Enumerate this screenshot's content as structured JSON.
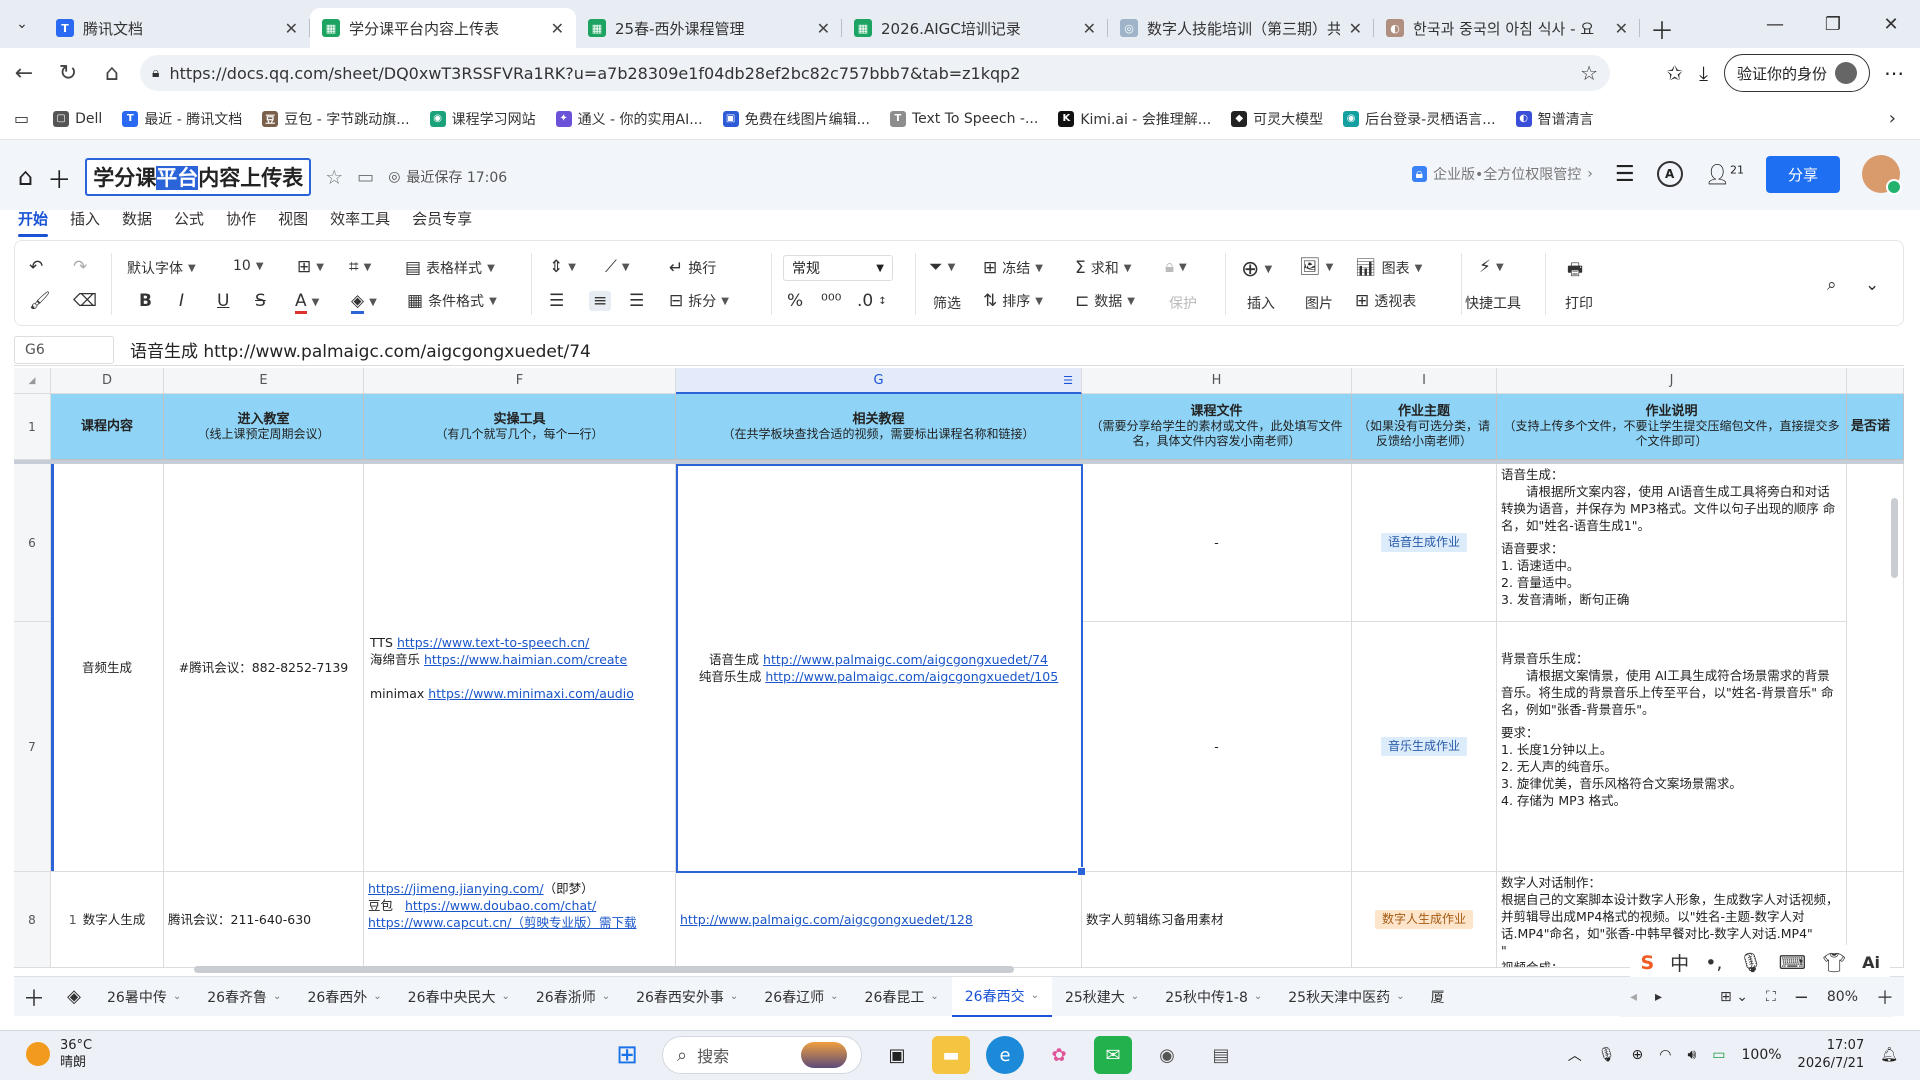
{
  "browser": {
    "tabs": [
      {
        "title": "腾讯文档",
        "color": "#2a6af2",
        "glyph": "T",
        "active": false
      },
      {
        "title": "学分课平台内容上传表",
        "color": "#1ea462",
        "glyph": "▦",
        "active": true
      },
      {
        "title": "25春-西外课程管理",
        "color": "#1ea462",
        "glyph": "▦",
        "active": false
      },
      {
        "title": "2026.AIGC培训记录",
        "color": "#1ea462",
        "glyph": "▦",
        "active": false
      },
      {
        "title": "数字人技能培训（第三期）共",
        "color": "#9fb4c8",
        "glyph": "◎",
        "active": false
      },
      {
        "title": "한국과 중국의 아침 식사 - 요",
        "color": "#b08f80",
        "glyph": "◐",
        "active": false
      }
    ],
    "url": "https://docs.qq.com/sheet/DQ0xwT3RSSFVRa1RK?u=a7b28309e1f04db28ef2bc82c757bbb7&tab=z1kqp2",
    "verify_label": "验证你的身份",
    "bookmarks": [
      {
        "label": "Dell",
        "color": "#555555",
        "glyph": "▢"
      },
      {
        "label": "最近 - 腾讯文档",
        "color": "#2a6af2",
        "glyph": "T"
      },
      {
        "label": "豆包 - 字节跳动旗...",
        "color": "#7a5f4b",
        "glyph": "豆"
      },
      {
        "label": "课程学习网站",
        "color": "#1aa37a",
        "glyph": "◉"
      },
      {
        "label": "通义 - 你的实用AI...",
        "color": "#6b52d8",
        "glyph": "✦"
      },
      {
        "label": "免费在线图片编辑...",
        "color": "#2e5bd6",
        "glyph": "▣"
      },
      {
        "label": "Text To Speech -...",
        "color": "#8d8d8d",
        "glyph": "T"
      },
      {
        "label": "Kimi.ai - 会推理解...",
        "color": "#111111",
        "glyph": "K"
      },
      {
        "label": "可灵大模型",
        "color": "#222222",
        "glyph": "◆"
      },
      {
        "label": "后台登录-灵栖语言...",
        "color": "#14a0a0",
        "glyph": "◉"
      },
      {
        "label": "智谱清言",
        "color": "#3a4fd8",
        "glyph": "◐"
      }
    ]
  },
  "doc": {
    "title_pre": "学分课",
    "title_hl": "平台",
    "title_post": "内容上传表",
    "save_status": "最近保存 17:06",
    "permission": "企业版•全方位权限管控",
    "collab_count": "21",
    "share_label": "分享",
    "menus": [
      "开始",
      "插入",
      "数据",
      "公式",
      "协作",
      "视图",
      "效率工具",
      "会员专享"
    ]
  },
  "toolbar": {
    "font": "默认字体",
    "size": "10",
    "wrap": "换行",
    "format": "常规",
    "table_style": "表格样式",
    "cond_format": "条件格式",
    "split": "拆分",
    "freeze": "冻结",
    "sum": "求和",
    "filter": "筛选",
    "sort": "排序",
    "data": "数据",
    "protect": "保护",
    "insert": "插入",
    "image": "图片",
    "chart": "图表",
    "pivot": "透视表",
    "quick_tools": "快捷工具",
    "print": "打印"
  },
  "formula": {
    "cell_ref": "G6",
    "content": "语音生成 http://www.palmaigc.com/aigcgongxuedet/74"
  },
  "grid": {
    "col_letters": [
      "D",
      "E",
      "F",
      "G",
      "H",
      "I",
      "J"
    ],
    "headers": {
      "D": {
        "title": "课程内容",
        "sub": ""
      },
      "E": {
        "title": "进入教室",
        "sub": "（线上课预定周期会议）"
      },
      "F": {
        "title": "实操工具",
        "sub": "（有几个就写几个，每个一行）"
      },
      "G": {
        "title": "相关教程",
        "sub": "（在共学板块查找合适的视频，需要标出课程名称和链接）"
      },
      "H": {
        "title": "课程文件",
        "sub": "（需要分享给学生的素材或文件，此处填写文件名，具体文件内容发小南老师）"
      },
      "I": {
        "title": "作业主题",
        "sub": "（如果没有可选分类，请反馈给小南老师）"
      },
      "J": {
        "title": "作业说明",
        "sub": "（支持上传多个文件，不要让学生提交压缩包文件，直接提交多个文件即可）"
      },
      "K": {
        "title": "是否诺",
        "sub": ""
      }
    },
    "row_numbers": [
      "1",
      "6",
      "7",
      "8"
    ],
    "audio": {
      "course": "音频生成",
      "meeting": "#腾讯会议：882-8252-7139",
      "tools": [
        {
          "name": "TTS",
          "link": "https://www.text-to-speech.cn/"
        },
        {
          "name": "海绵音乐",
          "link": "https://www.haimian.com/create"
        },
        {
          "name": "minimax",
          "link": "https://www.minimaxi.com/audio"
        }
      ],
      "tutorials": [
        {
          "name": "语音生成",
          "link": "http://www.palmaigc.com/aigcgongxuedet/74"
        },
        {
          "name": "纯音乐生成",
          "link": "http://www.palmaigc.com/aigcgongxuedet/105"
        }
      ],
      "file6": "-",
      "file7": "-",
      "topic6": "语音生成作业",
      "topic7": "音乐生成作业",
      "desc6": {
        "title": "语音生成：",
        "body": "请根据所文案内容，使用 AI语音生成工具将旁白和对话转换为语音，并保存为 MP3格式。文件以句子出现的顺序 命名，如\"姓名-语音生成1\"。",
        "req_title": "语音要求：",
        "reqs": [
          "1. 语速适中。",
          "2. 音量适中。",
          "3. 发音清晰，断句正确"
        ]
      },
      "desc7": {
        "title": "背景音乐生成：",
        "body": "请根据文案情景，使用 AI工具生成符合场景需求的背景音乐。将生成的背景音乐上传至平台，以\"姓名-背景音乐\" 命名，例如\"张香-背景音乐\"。",
        "req_title": "要求：",
        "reqs": [
          "1. 长度1分钟以上。",
          "2. 无人声的纯音乐。",
          "3. 旋律优美，音乐风格符合文案场景需求。",
          "4. 存储为 MP3 格式。"
        ]
      }
    },
    "digital": {
      "index": "1",
      "course": "数字人生成",
      "meeting": "腾讯会议：211-640-630",
      "tool1_link": "https://jimeng.jianying.com/",
      "tool1_note": "（即梦）",
      "tool2_name": "豆包",
      "tool2_link": "https://www.doubao.com/chat/",
      "tool3_link": "https://www.capcut.cn/（剪映专业版）需下载",
      "tutorial": "http://www.palmaigc.com/aigcgongxuedet/128",
      "file": "数字人剪辑练习备用素材",
      "topic": "数字人生成作业",
      "desc_title": "数字人对话制作：",
      "desc_body": "根据自己的文案脚本设计数字人形象，生成数字人对话视频，并剪辑导出成MP4格式的视频。以\"姓名-主题-数字人对话.MP4\"命名，如\"张香-中韩早餐对比-数字人对话.MP4\"",
      "desc_tail": "\"",
      "desc_cut": "视频合成："
    }
  },
  "sheets": {
    "tabs": [
      "26暑中传",
      "26春齐鲁",
      "26春西外",
      "26春中央民大",
      "26春浙师",
      "26春西安外事",
      "26春辽师",
      "26春昆工",
      "26春西交",
      "25秋建大",
      "25秋中传1-8",
      "25秋天津中医药",
      "厦"
    ],
    "active_index": 8,
    "zoom": "80%"
  },
  "taskbar": {
    "temp": "36°C",
    "weather": "晴朗",
    "search": "搜索",
    "battery": "100%",
    "time": "17:07",
    "date": "2026/7/21"
  }
}
